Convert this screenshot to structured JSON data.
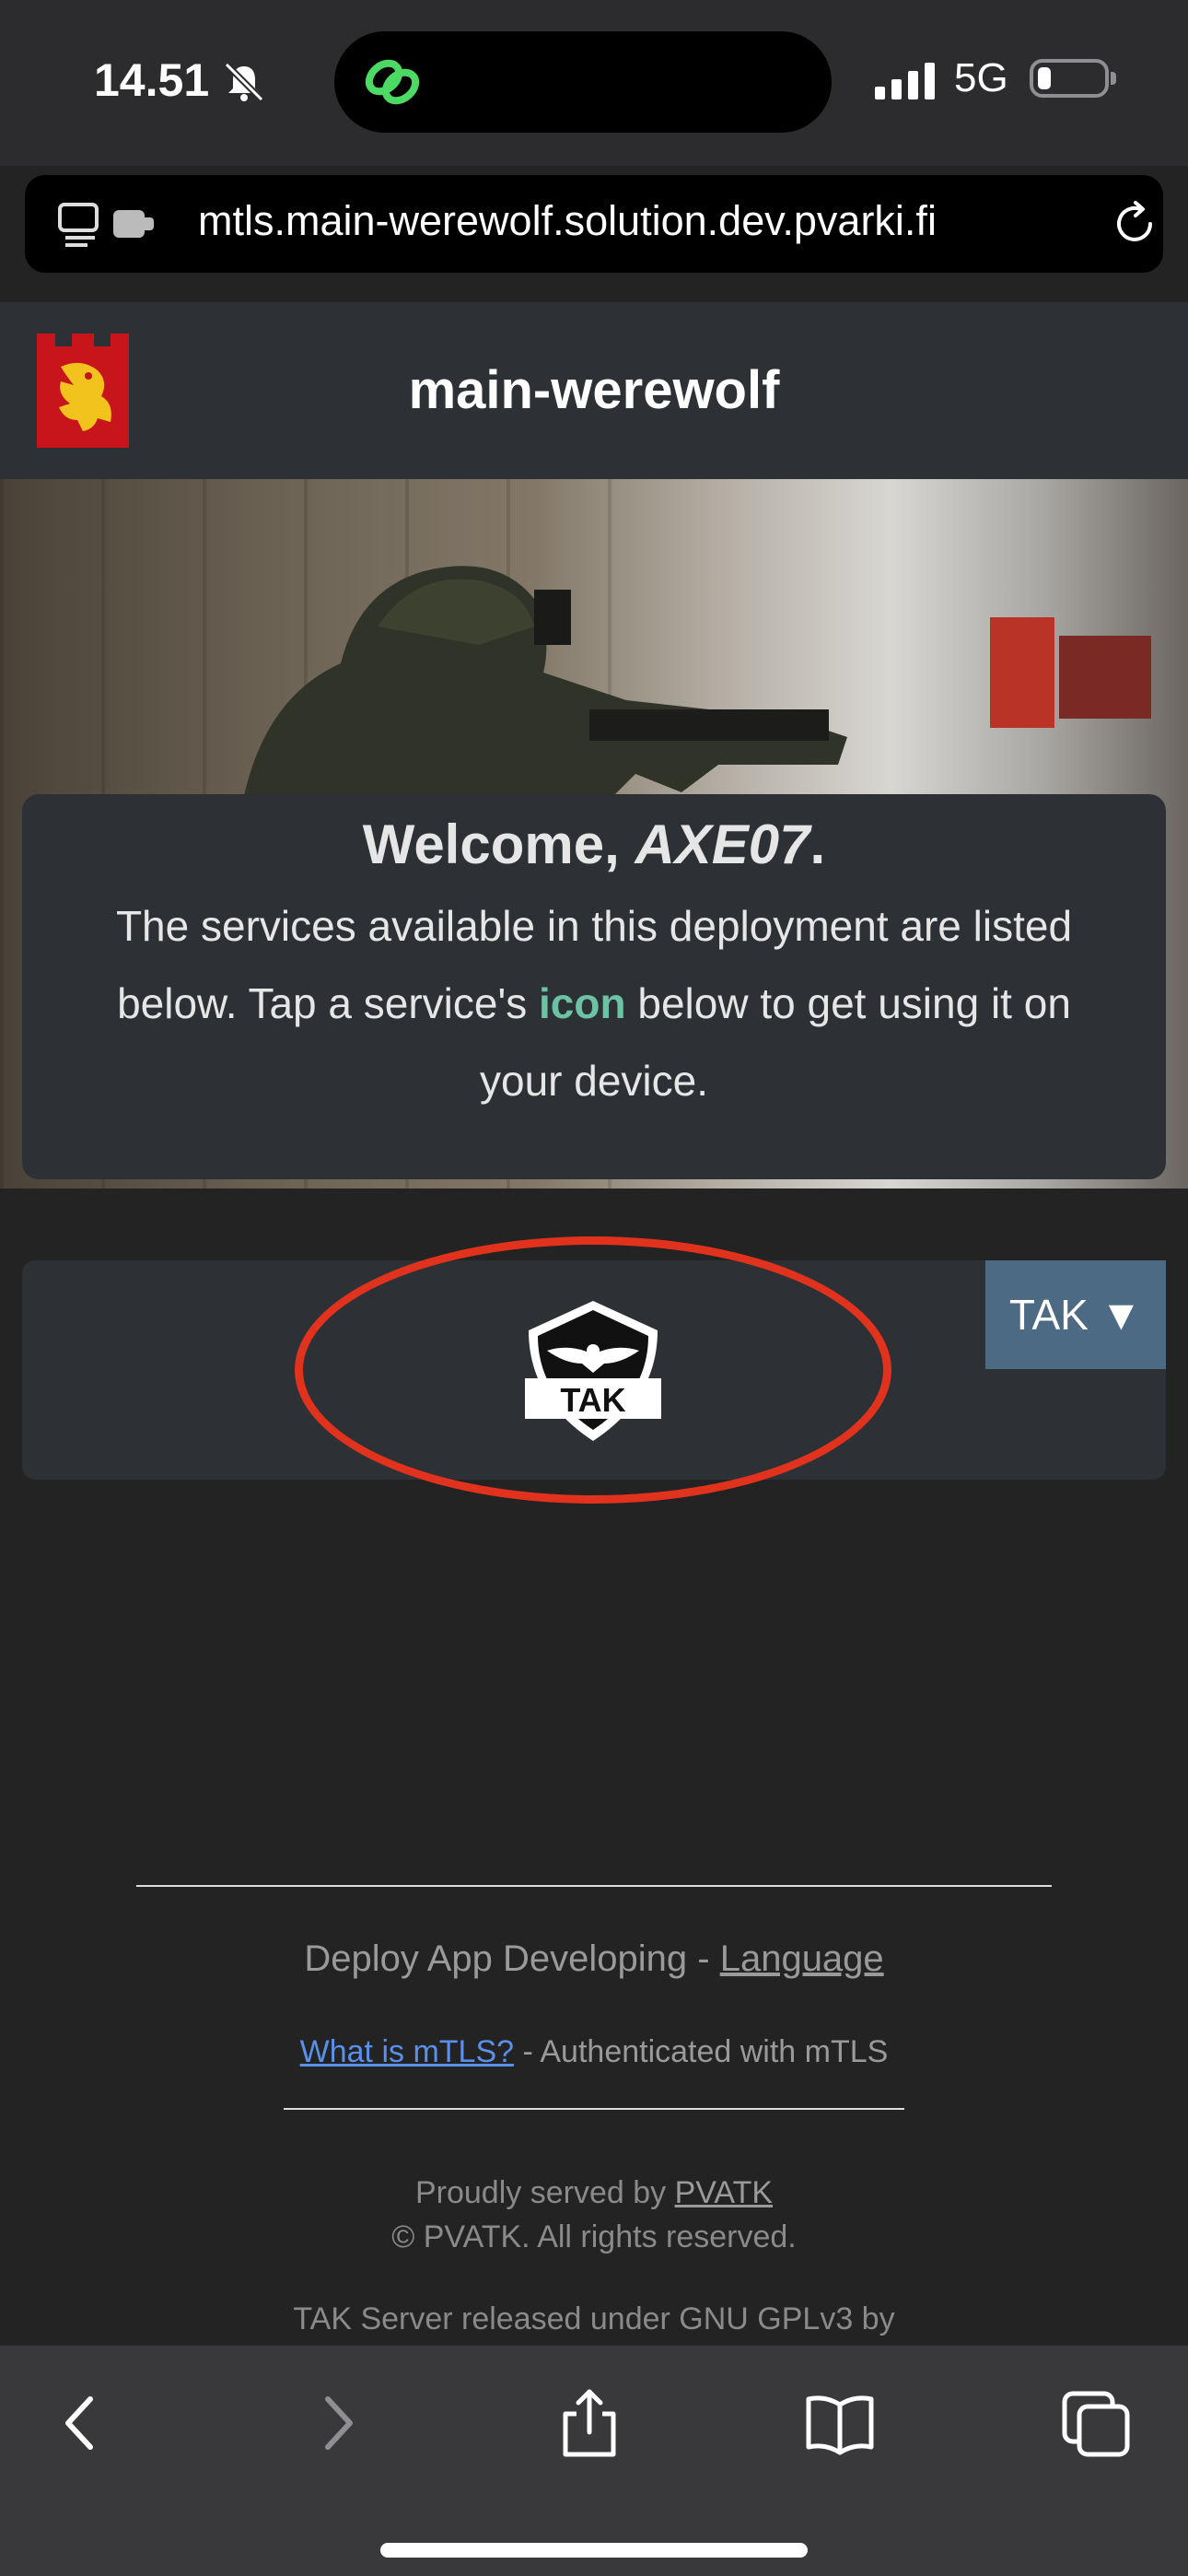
{
  "status_bar": {
    "time": "14.51",
    "network": "5G",
    "icons": [
      "bell-slash-icon",
      "link-icon",
      "signal-icon",
      "battery-icon"
    ]
  },
  "browser": {
    "url": "mtls.main-werewolf.solution.dev.pvarki.fi",
    "icons": [
      "tab-overview-icon",
      "reload-icon"
    ]
  },
  "header": {
    "title": "main-werewolf",
    "logo": "lion-crest-logo"
  },
  "welcome": {
    "greeting_prefix": "Welcome, ",
    "callsign": "AXE07",
    "greeting_suffix": ".",
    "text_before": "The services available in this deployment are listed below. Tap a service's ",
    "text_highlight": "icon",
    "text_after": " below to get using it on your device."
  },
  "services": {
    "selected_label": "TAK ▼",
    "tak_logo_text": "TAK"
  },
  "footer": {
    "line1_prefix": "Deploy App Developing - ",
    "language_link": "Language",
    "mtls_link": "What is mTLS?",
    "mtls_status": " - Authenticated with mTLS",
    "served_prefix": "Proudly served by ",
    "served_link": "PVATK",
    "copyright": "© PVATK. All rights reserved.",
    "tak_license": "TAK Server released under GNU GPLv3 by"
  },
  "toolbar": {
    "icons": [
      "back-icon",
      "forward-icon",
      "share-icon",
      "bookmarks-icon",
      "tabs-icon"
    ]
  },
  "colors": {
    "accent_highlight": "#6cc3a3",
    "annotation_ring": "#e0321c",
    "dropdown_bg": "#4c6a84",
    "link_blue": "#5a8fea"
  }
}
